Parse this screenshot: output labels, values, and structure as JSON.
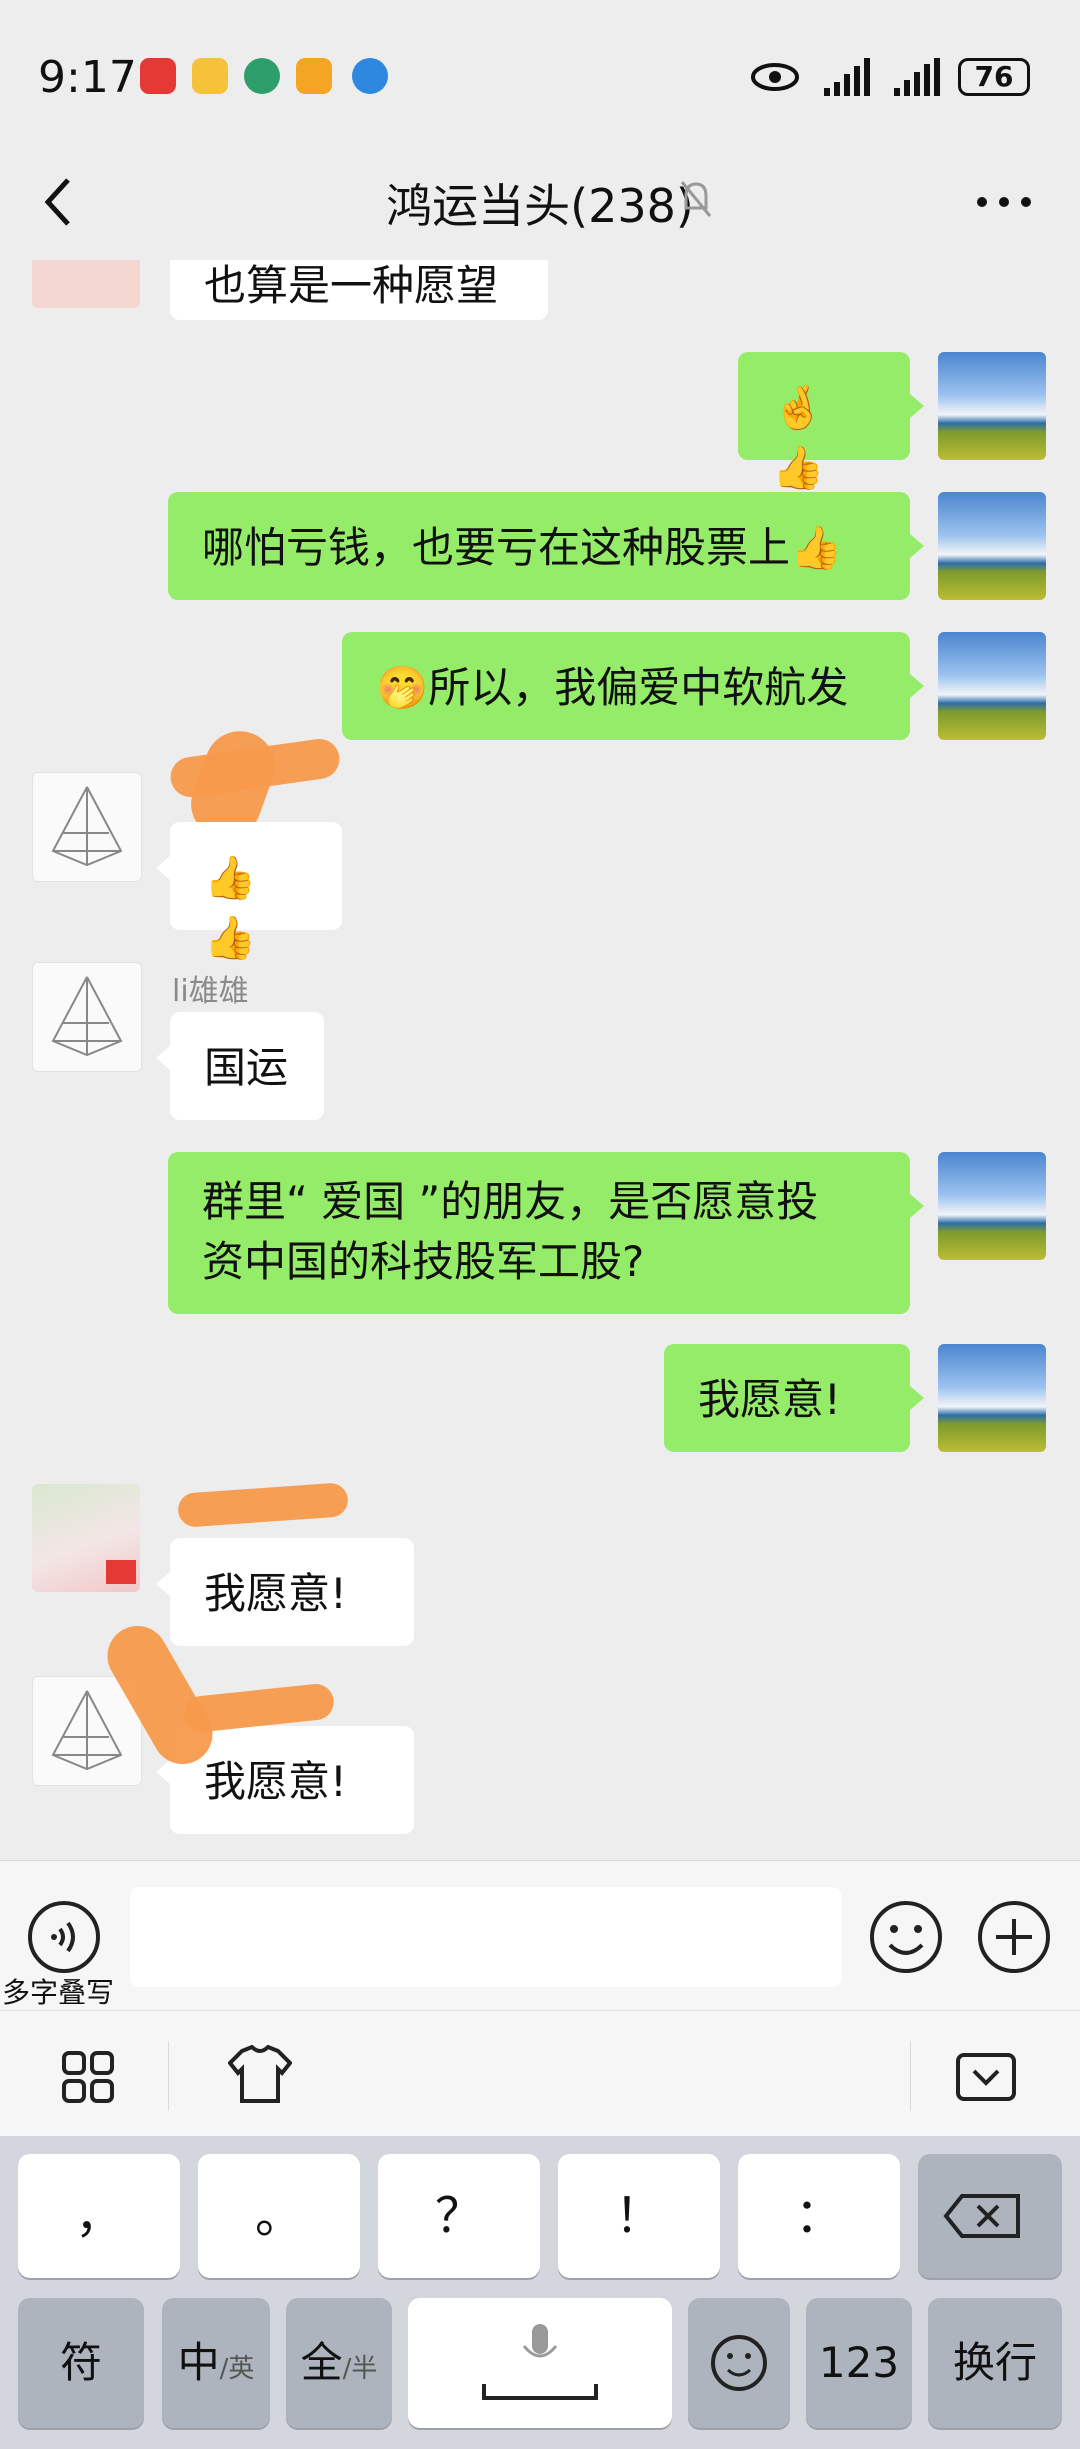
{
  "status_bar": {
    "time": "9:17",
    "battery": "76",
    "icons": [
      "huawei-app-icon",
      "weibo-icon",
      "bank-icon",
      "weibo-icon",
      "browser-icon",
      "eye-icon",
      "signal-icon",
      "signal-icon",
      "battery-icon"
    ]
  },
  "header": {
    "title": "鸿运当头(238)",
    "back_icon": "chevron-left-icon",
    "mute_icon": "bell-muted-icon",
    "more_icon": "more-dots-icon"
  },
  "messages": [
    {
      "side": "other",
      "text": "也算是一种愿望"
    },
    {
      "side": "me",
      "text": "🤞👍"
    },
    {
      "side": "me",
      "text": "哪怕亏钱，也要亏在这种股票上👍"
    },
    {
      "side": "me",
      "text": "🤭所以，我偏爱中软航发"
    },
    {
      "side": "other",
      "text": "👍👍"
    },
    {
      "side": "other",
      "nickname": "li雄雄",
      "text": "国运"
    },
    {
      "side": "me",
      "text_line1": "群里“ 爱国 ”的朋友，是否愿意投",
      "text_line2": "资中国的科技股军工股?"
    },
    {
      "side": "me",
      "text": "我愿意!"
    },
    {
      "side": "other",
      "text": "我愿意!"
    },
    {
      "side": "other",
      "text": "我愿意!"
    }
  ],
  "input": {
    "voice_label": "多字叠写",
    "placeholder": "",
    "emoji_icon": "smiley-icon",
    "plus_icon": "plus-circle-icon"
  },
  "keyboard": {
    "row1": [
      "，",
      "。",
      "？",
      "！",
      "："
    ],
    "row2": {
      "symbol": "符",
      "lang_main": "中",
      "lang_sub": "/英",
      "width_main": "全",
      "width_sub": "/半",
      "num": "123",
      "enter": "换行"
    }
  }
}
